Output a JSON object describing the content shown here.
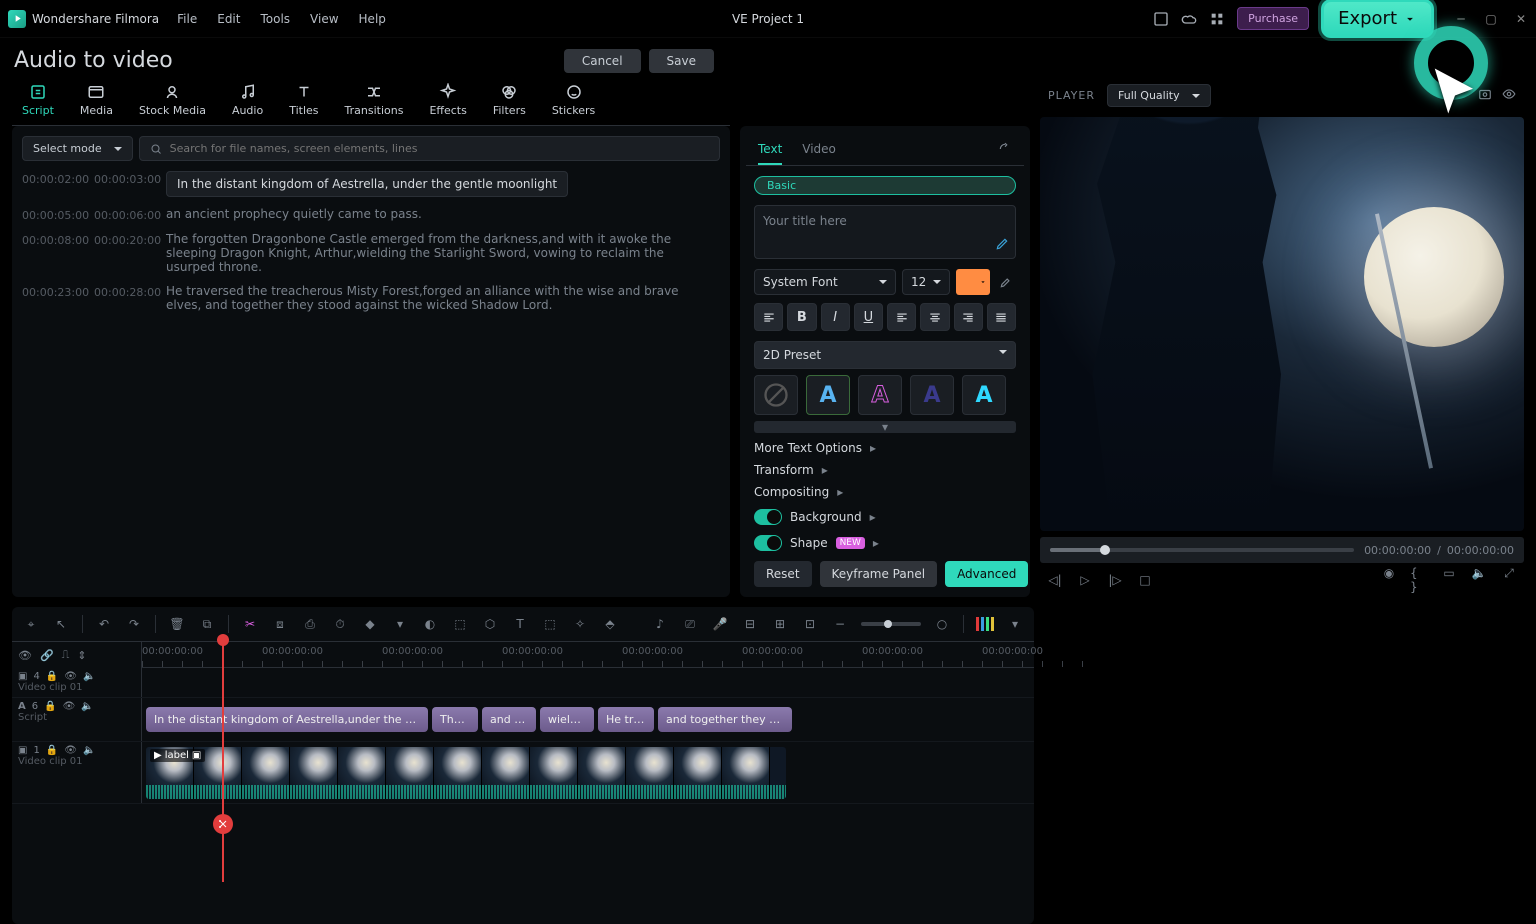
{
  "app": {
    "name": "Wondershare Filmora",
    "project": "VE Project 1",
    "menu": [
      "File",
      "Edit",
      "Tools",
      "View",
      "Help"
    ],
    "purchase": "Purchase",
    "export": "Export"
  },
  "section": {
    "title": "Audio to video",
    "cancel": "Cancel",
    "save": "Save"
  },
  "tabs": [
    "Script",
    "Media",
    "Stock Media",
    "Audio",
    "Titles",
    "Transitions",
    "Effects",
    "Filters",
    "Stickers"
  ],
  "script_panel": {
    "select_mode": "Select mode",
    "search_placeholder": "Search for file names, screen elements, lines",
    "rows": [
      {
        "start": "00:00:02:00",
        "end": "00:00:03:00",
        "text": "In the distant kingdom of Aestrella, under the gentle moonlight",
        "boxed": true
      },
      {
        "start": "00:00:05:00",
        "end": "00:00:06:00",
        "text": "an ancient prophecy quietly came to pass.",
        "boxed": false
      },
      {
        "start": "00:00:08:00",
        "end": "00:00:20:00",
        "text": "The forgotten Dragonbone Castle emerged from the darkness,and with it awoke the sleeping Dragon Knight, Arthur,wielding the Starlight Sword, vowing to reclaim the usurped throne.",
        "boxed": false
      },
      {
        "start": "00:00:23:00",
        "end": "00:00:28:00",
        "text": "He traversed the treacherous Misty Forest,forged an alliance with the wise and brave elves, and together they stood against the wicked Shadow Lord.",
        "boxed": false
      }
    ]
  },
  "text_panel": {
    "tabs": {
      "text": "Text",
      "video": "Video"
    },
    "basic": "Basic",
    "placeholder": "Your title here",
    "font": "System Font",
    "size": "12",
    "color": "#ff8c42",
    "preset_label": "2D Preset",
    "more_text_options": "More Text Options",
    "transform": "Transform",
    "compositing": "Compositing",
    "background": "Background",
    "shape": "Shape",
    "new_badge": "NEW",
    "reset": "Reset",
    "keyframe": "Keyframe Panel",
    "advanced": "Advanced"
  },
  "player": {
    "label": "PLAYER",
    "quality": "Full Quality",
    "time_current": "00:00:00:00",
    "time_sep": "/",
    "time_total": "00:00:00:00"
  },
  "timeline": {
    "ruler_labels": [
      "00:00:00:00",
      "00:00:00:00",
      "00:00:00:00",
      "00:00:00:00",
      "00:00:00:00",
      "00:00:00:00",
      "00:00:00:00",
      "00:00:00:00"
    ],
    "tracks": [
      {
        "icon": "camera",
        "num": "4",
        "name": "Video clip 01"
      },
      {
        "icon": "A",
        "num": "6",
        "name": "Script"
      },
      {
        "icon": "camera",
        "num": "1",
        "name": "Video clip 01"
      }
    ],
    "script_clips": [
      "In the distant kingdom of Aestrella,under the gentle moonlight,an…",
      "The fo…",
      "and with i…",
      "wielding t…",
      "He travers…",
      "and together they stood agai…"
    ],
    "video_label": "label"
  }
}
